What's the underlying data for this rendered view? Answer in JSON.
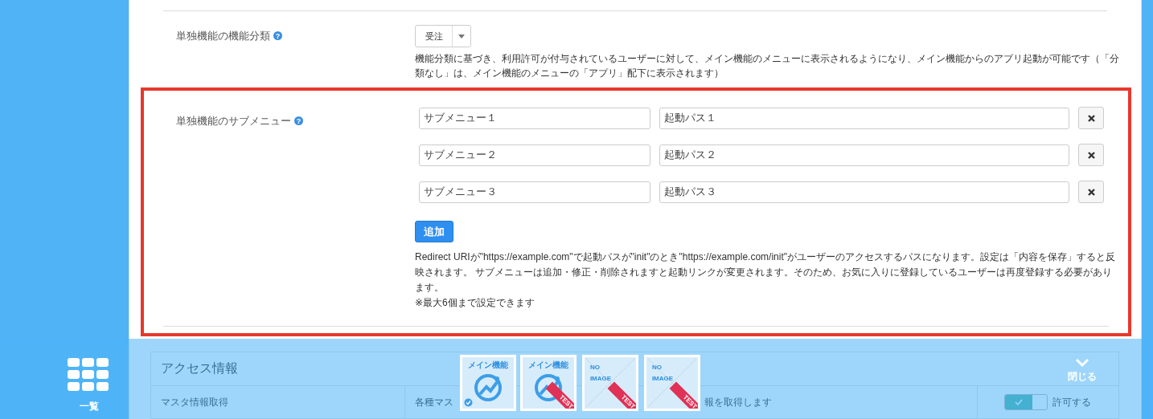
{
  "sidebar": {
    "list_label": "一覧"
  },
  "classification": {
    "label": "単独機能の機能分類",
    "help_icon": "?",
    "select_value": "受注",
    "description": "機能分類に基づき、利用許可が付与されているユーザーに対して、メイン機能のメニューに表示されるようになり、メイン機能からのアプリ起動が可能です（「分類なし」は、メイン機能のメニューの「アプリ」配下に表示されます）"
  },
  "submenu": {
    "label": "単独機能のサブメニュー",
    "help_icon": "?",
    "rows": [
      {
        "name": "サブメニュー１",
        "path": "起動パス１"
      },
      {
        "name": "サブメニュー２",
        "path": "起動パス２"
      },
      {
        "name": "サブメニュー３",
        "path": "起動パス３"
      }
    ],
    "add_button": "追加",
    "note": "Redirect URIが\"https://example.com\"で起動パスが\"init\"のとき\"https://example.com/init\"がユーザーのアクセスするパスになります。設定は「内容を保存」すると反映されます。 サブメニューは追加・修正・削除されますと起動リンクが変更されます。そのため、お気に入りに登録しているユーザーは再度登録する必要があります。",
    "limit_note": "※最大6個まで設定できます"
  },
  "access": {
    "title": "アクセス情報",
    "rows": [
      {
        "label": "マスタ情報取得",
        "desc_start": "各種マス",
        "desc_end": "報を取得します",
        "toggle_on": true,
        "toggle_label": "許可する"
      }
    ]
  },
  "dock": {
    "tiles": [
      {
        "kind": "app",
        "label": "メイン機能",
        "installed": true
      },
      {
        "kind": "app",
        "label": "メイン機能",
        "ribbon": "TEST",
        "installed": false
      },
      {
        "kind": "noimage",
        "label": "NO",
        "label2": "IMAGE",
        "ribbon": "TEST",
        "installed": false
      },
      {
        "kind": "noimage",
        "label": "NO",
        "label2": "IMAGE",
        "ribbon": "TEST",
        "installed": false
      }
    ],
    "close_label": "閉じる"
  }
}
